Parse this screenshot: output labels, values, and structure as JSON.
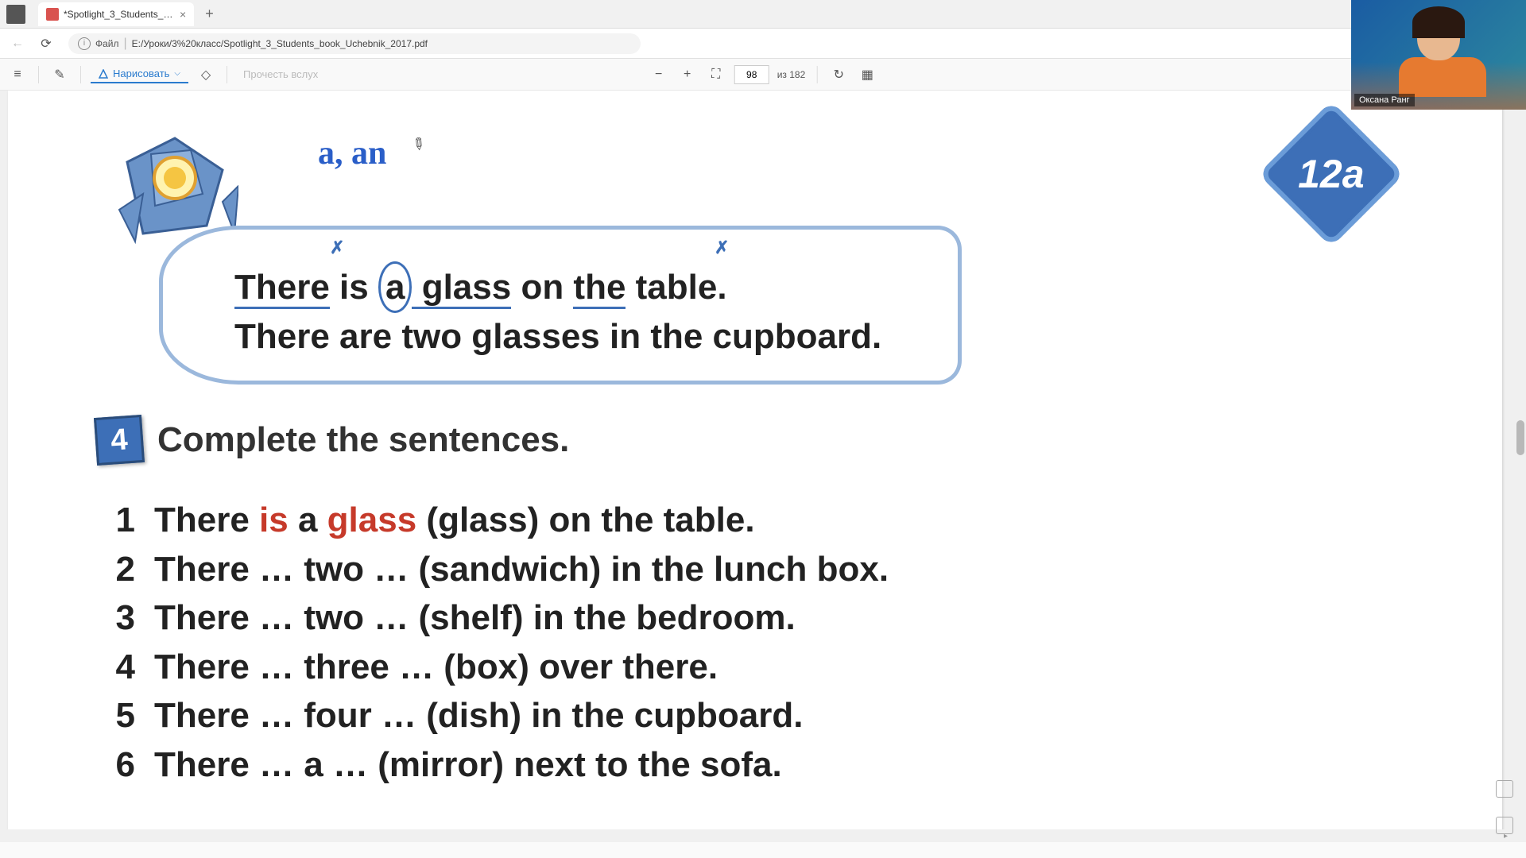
{
  "tab": {
    "title": "*Spotlight_3_Students_book_Uc",
    "close": "×"
  },
  "newTab": "+",
  "addr": {
    "file_label": "Файл",
    "file_path": "E:/Уроки/3%20класс/Spotlight_3_Students_book_Uchebnik_2017.pdf"
  },
  "toolbar": {
    "draw": "Нарисовать",
    "read": "Прочесть вслух",
    "page_current": "98",
    "page_total": "из 182"
  },
  "annotation": "a, an",
  "rule": {
    "line1_there": "There",
    "line1_is": " is ",
    "line1_a": "a",
    "line1_glass": " glass",
    "line1_rest1": " on ",
    "line1_the": "the",
    "line1_rest2": " table.",
    "line2": "There are two glasses in the cupboard."
  },
  "badge": "12a",
  "task": {
    "num": "4",
    "title": "Complete the sentences.",
    "items": [
      {
        "n": "1",
        "pre": "There ",
        "red1": "is",
        "mid": " a ",
        "red2": "glass",
        "rest": " (glass) on the table."
      },
      {
        "n": "2",
        "text": "There … two … (sandwich) in the lunch box."
      },
      {
        "n": "3",
        "text": "There … two … (shelf) in the bedroom."
      },
      {
        "n": "4",
        "text": "There … three … (box) over there."
      },
      {
        "n": "5",
        "text": "There … four … (dish) in the cupboard."
      },
      {
        "n": "6",
        "text": "There … a … (mirror) next to the sofa."
      }
    ]
  },
  "webcam": {
    "name": "Оксана Ранг"
  }
}
